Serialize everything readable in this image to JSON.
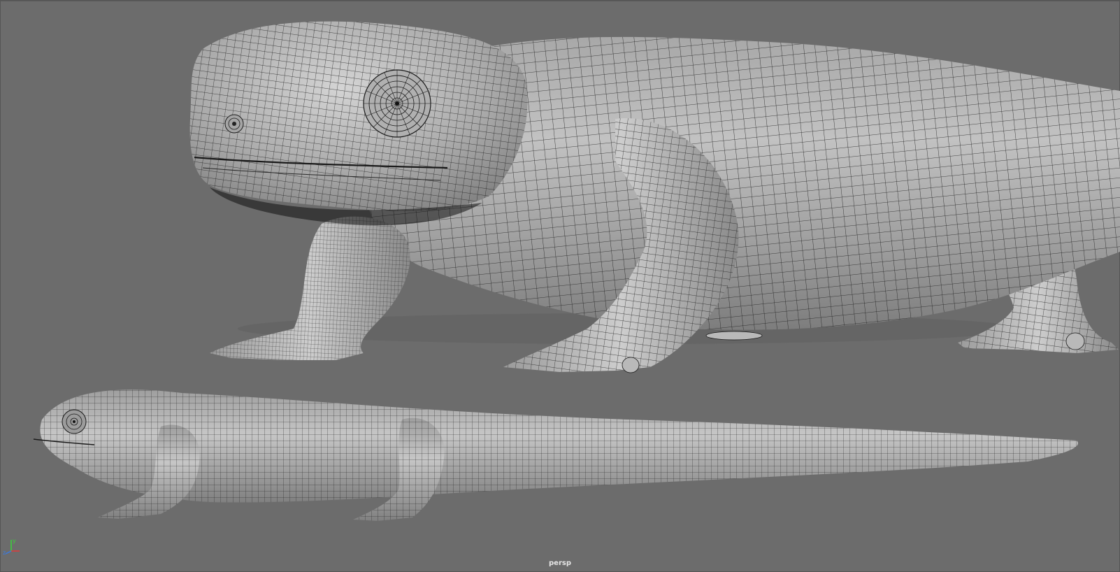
{
  "viewport": {
    "camera_label": "persp",
    "axis": {
      "y_label": "y",
      "z_label": "z"
    },
    "background_color": "#6b6b6b",
    "mesh_color": "#b8b8b8",
    "wire_color": "#1a1a1a"
  },
  "scene": {
    "closeup_model": "salamander-closeup-mesh",
    "full_model": "salamander-full-side-mesh"
  }
}
